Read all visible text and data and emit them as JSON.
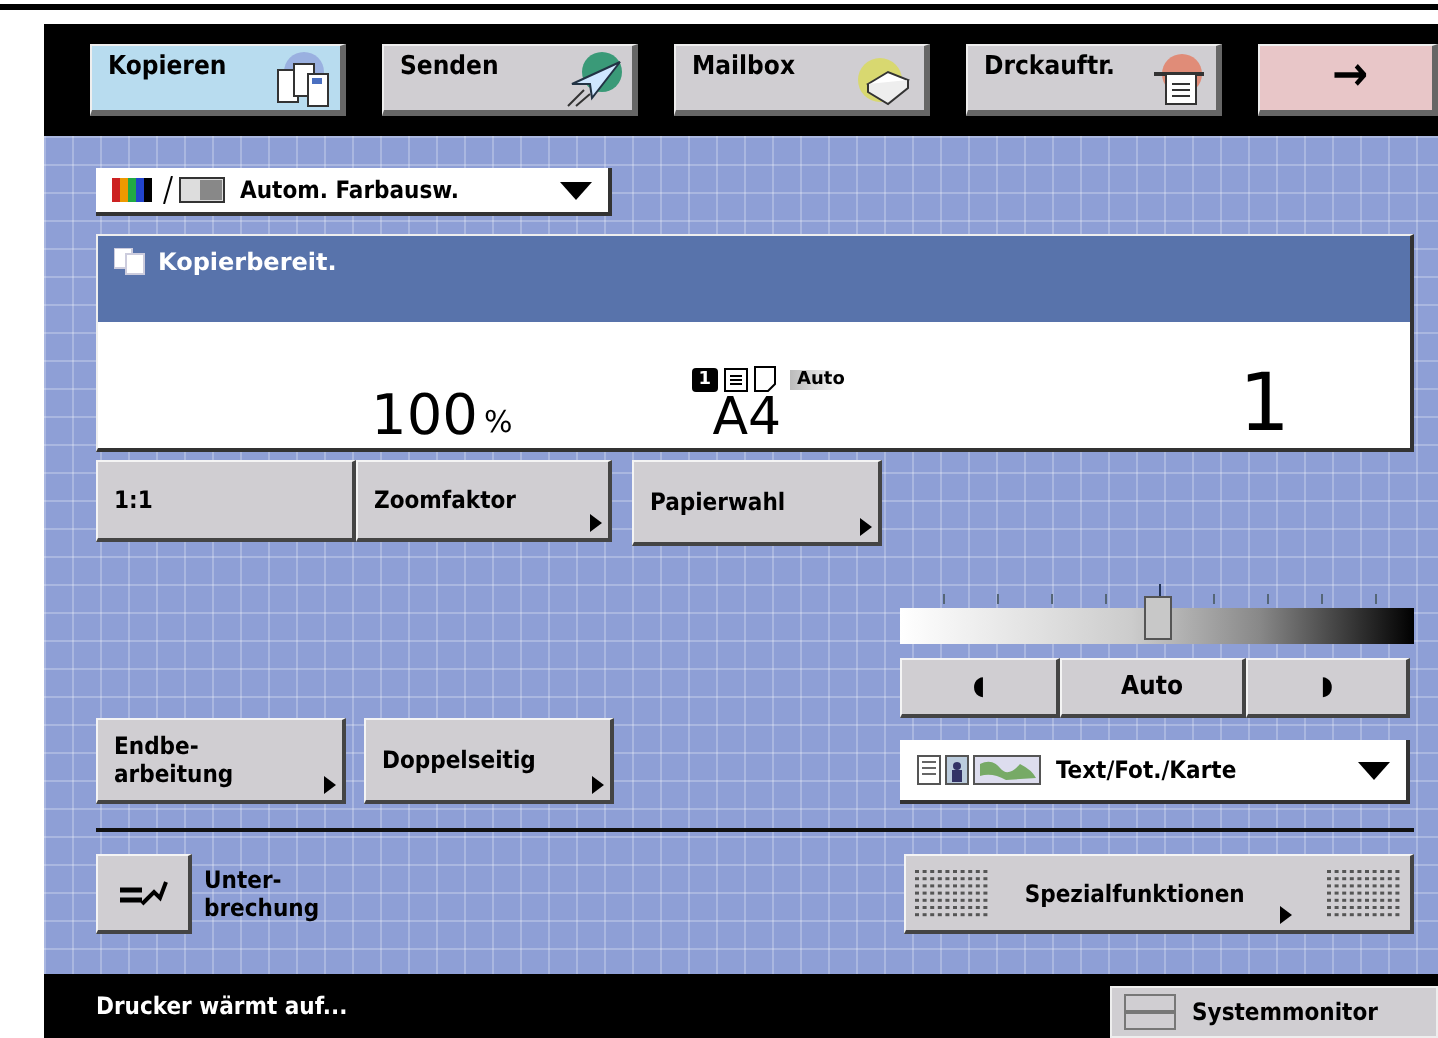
{
  "tabs": [
    {
      "label": "Kopieren",
      "kind": "tab",
      "selected": true
    },
    {
      "label": "Senden",
      "kind": "tab",
      "selected": false
    },
    {
      "label": "Mailbox",
      "kind": "tab",
      "selected": false
    },
    {
      "label": "Drckauftr.",
      "kind": "tab",
      "selected": false
    },
    {
      "label": "→",
      "kind": "arrow",
      "selected": false
    }
  ],
  "color_mode": {
    "value": "Autom. Farbausw."
  },
  "display": {
    "message": "Kopierbereit.",
    "zoom": "100",
    "zoom_unit": "%",
    "tray": "1",
    "paper_mode": "Auto",
    "paper_size": "A4",
    "copies": "1"
  },
  "zoom_buttons": [
    {
      "label": "1:1",
      "submenu": false
    },
    {
      "label": "Zoomfaktor",
      "submenu": true
    }
  ],
  "paper_button": {
    "label": "Papierwahl",
    "submenu": true
  },
  "density": {
    "level": 0.5,
    "lighter": "◖",
    "auto": "Auto",
    "darker": "◗"
  },
  "finishing_buttons": [
    {
      "label": "Endbe-\narbeitung",
      "submenu": true
    },
    {
      "label": "Doppelseitig",
      "submenu": true
    }
  ],
  "original_type": {
    "value": "Text/Fot./Karte"
  },
  "interrupt": {
    "label": "Unter-\nbrechung"
  },
  "special_button": {
    "label": "Spezialfunktionen"
  },
  "status_bar": {
    "message": "Drucker wärmt auf...",
    "monitor": "Systemmonitor"
  }
}
